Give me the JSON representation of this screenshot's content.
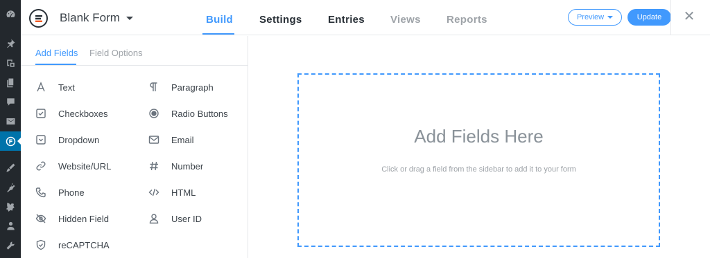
{
  "header": {
    "form_title": "Blank Form",
    "nav": [
      "Build",
      "Settings",
      "Entries",
      "Views",
      "Reports"
    ],
    "preview_label": "Preview",
    "update_label": "Update",
    "close_glyph": "✕"
  },
  "sidebar": {
    "tabs": [
      "Add Fields",
      "Field Options"
    ],
    "fields_left": [
      "Text",
      "Checkboxes",
      "Dropdown",
      "Website/URL",
      "Phone",
      "Hidden Field",
      "reCAPTCHA"
    ],
    "fields_right": [
      "Paragraph",
      "Radio Buttons",
      "Email",
      "Number",
      "HTML",
      "User ID"
    ]
  },
  "canvas": {
    "title": "Add Fields Here",
    "subtitle": "Click or drag a field from the sidebar to add it to your form"
  },
  "colors": {
    "accent": "#4199fd",
    "wp_bar": "#23282d",
    "wp_active": "#0073aa"
  },
  "icons": {
    "wp_bar": [
      "dashboard-icon",
      "pin-icon",
      "media-icon",
      "pages-icon",
      "comments-icon",
      "mail-icon",
      "formidable-icon",
      "appearance-icon",
      "plugins-icon",
      "tools-icon",
      "users-icon",
      "settings-icon"
    ],
    "fields_left": [
      "text-icon",
      "checkbox-icon",
      "dropdown-icon",
      "link-icon",
      "phone-icon",
      "hidden-icon",
      "shield-icon"
    ],
    "fields_right": [
      "paragraph-icon",
      "radio-icon",
      "email-icon",
      "hash-icon",
      "code-icon",
      "user-icon"
    ]
  }
}
